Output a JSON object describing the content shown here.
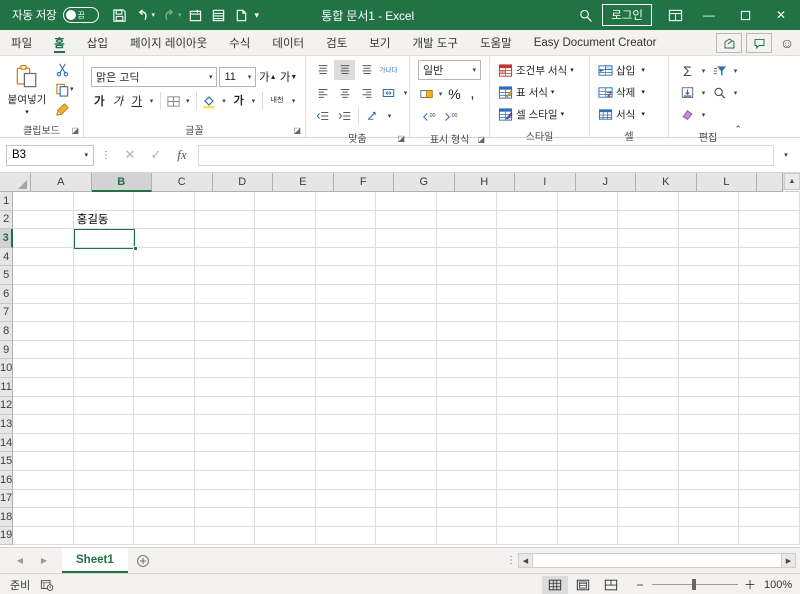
{
  "titlebar": {
    "autosave_label": "자동 저장",
    "autosave_state": "끔",
    "document_title": "통합 문서1  -  Excel",
    "signin_label": "로그인",
    "quick_access": [
      {
        "name": "save-icon",
        "label": "저장"
      },
      {
        "name": "undo-icon",
        "label": "실행 취소"
      },
      {
        "name": "redo-icon",
        "label": "다시 실행"
      },
      {
        "name": "new-sheet-icon",
        "label": "새 시트"
      },
      {
        "name": "rows-icon",
        "label": "행"
      },
      {
        "name": "page-icon",
        "label": "페이지"
      },
      {
        "name": "customize-qat-icon",
        "label": "빠른 실행 도구 모음 사용자 지정"
      }
    ],
    "window_controls": {
      "minimize": "—",
      "maximize": "▫",
      "close": "✕"
    },
    "search_icon": "search-icon",
    "ribbon_display_icon": "ribbon-display-icon"
  },
  "tabs": [
    {
      "label": "파일",
      "active": false
    },
    {
      "label": "홈",
      "active": true
    },
    {
      "label": "삽입",
      "active": false
    },
    {
      "label": "페이지 레이아웃",
      "active": false
    },
    {
      "label": "수식",
      "active": false
    },
    {
      "label": "데이터",
      "active": false
    },
    {
      "label": "검토",
      "active": false
    },
    {
      "label": "보기",
      "active": false
    },
    {
      "label": "개발 도구",
      "active": false
    },
    {
      "label": "도움말",
      "active": false
    },
    {
      "label": "Easy Document Creator",
      "active": false
    }
  ],
  "tab_right": {
    "share_label": "공유",
    "comment_label": "메모",
    "smiley_label": "피드백"
  },
  "ribbon": {
    "clipboard": {
      "title": "클립보드",
      "paste_label": "붙여넣기",
      "cut_label": "잘라내기",
      "copy_label": "복사",
      "format_painter_label": "서식 복사"
    },
    "font": {
      "title": "글꼴",
      "font_name": "맑은 고딕",
      "font_size": "11",
      "grow_label": "가",
      "shrink_label": "가",
      "bold_label": "가",
      "italic_label": "가",
      "underline_label": "가",
      "border_label": "테두리",
      "fill_label": "채우기 색",
      "fontcolor_label": "가",
      "phonetic_label": "내천"
    },
    "alignment": {
      "title": "맞춤",
      "wrap_label": "가나다",
      "merge_label": "병합하고 가운데 맞춤"
    },
    "number": {
      "title": "표시 형식",
      "format_value": "일반",
      "percent_label": "%",
      "comma_label": ",",
      "increase_decimal_label": ".00",
      "decrease_decimal_label": ".00"
    },
    "styles": {
      "title": "스타일",
      "items": [
        {
          "label": "조건부 서식",
          "icon": "conditional-format-icon"
        },
        {
          "label": "표 서식",
          "icon": "table-format-icon"
        },
        {
          "label": "셀 스타일",
          "icon": "cell-styles-icon"
        }
      ]
    },
    "cells": {
      "title": "셀",
      "items": [
        {
          "label": "삽입",
          "icon": "insert-cells-icon"
        },
        {
          "label": "삭제",
          "icon": "delete-cells-icon"
        },
        {
          "label": "서식",
          "icon": "format-cells-icon"
        }
      ]
    },
    "editing": {
      "title": "편집",
      "autosum_label": "자동 합계",
      "sort_filter_label": "정렬 및 필터",
      "fill_label": "채우기",
      "find_label": "찾기 및 선택",
      "clear_label": "지우기"
    }
  },
  "formulabar": {
    "namebox_value": "B3",
    "formula_value": "",
    "cancel_label": "취소",
    "enter_label": "입력",
    "fx_label": "fx"
  },
  "grid": {
    "columns": [
      "A",
      "B",
      "C",
      "D",
      "E",
      "F",
      "G",
      "H",
      "I",
      "J",
      "K",
      "L"
    ],
    "rows": [
      "1",
      "2",
      "3",
      "4",
      "5",
      "6",
      "7",
      "8",
      "9",
      "10",
      "11",
      "12",
      "13",
      "14",
      "15",
      "16",
      "17",
      "18",
      "19"
    ],
    "selected_column": "B",
    "selected_row": "3",
    "cells": [
      {
        "row": "2",
        "col": "B",
        "value": "홍길동"
      }
    ]
  },
  "sheetbar": {
    "sheets": [
      {
        "label": "Sheet1",
        "active": true
      }
    ],
    "add_sheet_label": "＋",
    "prev_label": "◀",
    "next_label": "▶"
  },
  "statusbar": {
    "status_text": "준비",
    "accessibility_icon": "accessibility-check-icon",
    "views": [
      {
        "name": "normal-view-button",
        "selected": true
      },
      {
        "name": "page-layout-view-button",
        "selected": false
      },
      {
        "name": "page-break-view-button",
        "selected": false
      }
    ],
    "zoom_minus": "−",
    "zoom_plus": "＋",
    "zoom_level": "100%"
  },
  "colors": {
    "brand_green": "#217346",
    "ribbon_bg": "#f3f2f1",
    "header_gray": "#e6e6e6",
    "gridline": "#dcdcdc"
  }
}
